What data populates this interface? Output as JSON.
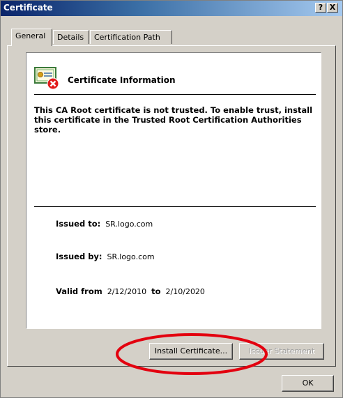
{
  "window": {
    "title": "Certificate",
    "help_label": "?",
    "close_label": "X"
  },
  "tabs": [
    {
      "label": "General"
    },
    {
      "label": "Details"
    },
    {
      "label": "Certification Path"
    }
  ],
  "general": {
    "heading": "Certificate Information",
    "warning": "This CA Root certificate is not trusted. To enable trust, install this certificate in the Trusted Root Certification Authorities store.",
    "issued_to_label": "Issued to:",
    "issued_to_value": "SR.logo.com",
    "issued_by_label": "Issued by:",
    "issued_by_value": "SR.logo.com",
    "valid_from_label": "Valid from",
    "valid_from_value": "2/12/2010",
    "to_label": "to",
    "valid_to_value": "2/10/2020"
  },
  "buttons": {
    "install_certificate": "Install Certificate...",
    "issuer_statement": "Issuer Statement",
    "ok": "OK"
  },
  "annotation": {
    "color": "#e3000f"
  },
  "colors": {
    "title_gradient_start": "#0a246a",
    "dialog_face": "#d4d0c8"
  }
}
